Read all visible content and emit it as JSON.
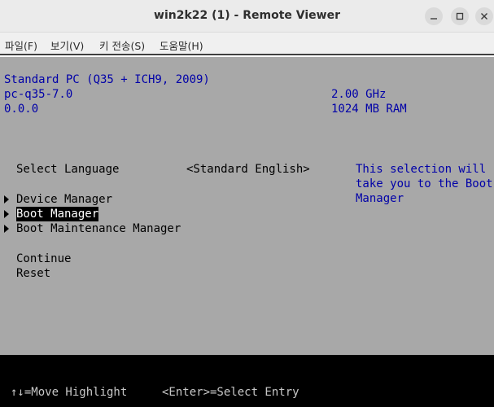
{
  "window": {
    "title": "win2k22 (1) - Remote Viewer",
    "buttons": [
      "minimize-icon",
      "maximize-icon",
      "close-icon"
    ]
  },
  "menu": [
    "파일(F)",
    "보기(V)",
    "키 전송(S)",
    "도움말(H)"
  ],
  "bios": {
    "machine": "Standard PC (Q35 + ICH9, 2009)",
    "version": "pc-q35-7.0",
    "revision": "0.0.0",
    "cpu_speed": "2.00 GHz",
    "ram": "1024 MB RAM",
    "language_label": "Select Language",
    "language_value": "<Standard English>",
    "help_lines": [
      "This selection will",
      "take you to the Boot",
      "Manager"
    ],
    "menu_items": [
      "Device Manager",
      "Boot Manager",
      "Boot Maintenance Manager"
    ],
    "selected_item": "Boot Manager",
    "actions": [
      "Continue",
      "Reset"
    ],
    "footer": {
      "move": "↑↓=Move Highlight",
      "enter": "<Enter>=Select Entry"
    }
  },
  "colors": {
    "screen_bg": "#a8a8a8",
    "info_text": "#0000a8",
    "highlight_bg": "#000000",
    "highlight_text": "#ffffff"
  }
}
